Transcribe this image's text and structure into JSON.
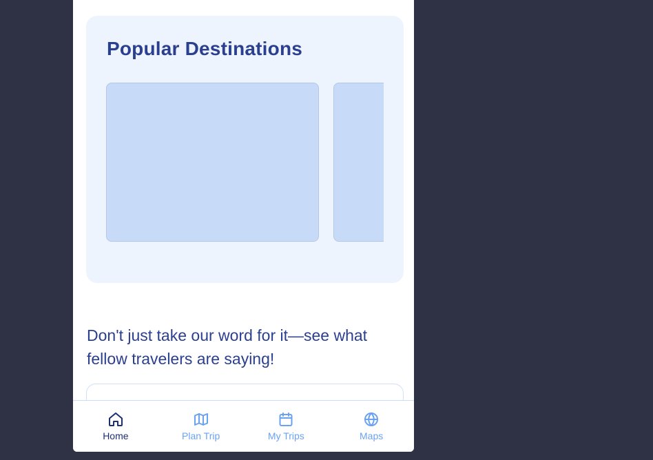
{
  "popular_destinations": {
    "title": "Popular Destinations",
    "cards": [
      {
        "label": ""
      },
      {
        "label": ""
      }
    ]
  },
  "testimonials": {
    "intro": "Don't just take our word for it—see what fellow travelers are saying!"
  },
  "bottom_nav": {
    "items": [
      {
        "label": "Home",
        "icon": "home-icon",
        "active": true
      },
      {
        "label": "Plan Trip",
        "icon": "map-icon",
        "active": false
      },
      {
        "label": "My Trips",
        "icon": "calendar-icon",
        "active": false
      },
      {
        "label": "Maps",
        "icon": "globe-icon",
        "active": false
      }
    ]
  },
  "colors": {
    "background": "#2e3244",
    "accent": "#2b3f8f",
    "section_bg": "#eef4fe",
    "card_placeholder": "#c7dbf8",
    "nav_inactive": "#6aa2f2",
    "nav_active": "#1d2f6f"
  }
}
